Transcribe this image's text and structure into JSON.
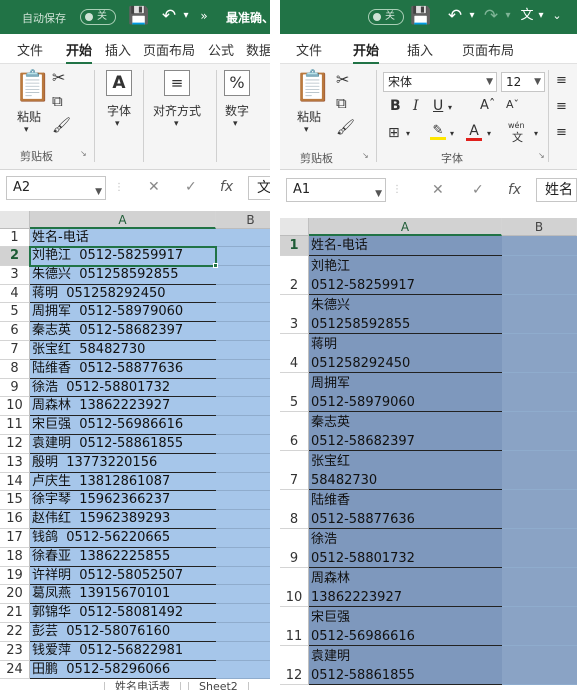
{
  "left": {
    "autosave_label": "自动保存",
    "autosave_state": "关",
    "doc_title": "最准确、",
    "tabs": [
      "文件",
      "开始",
      "插入",
      "页面布局",
      "公式",
      "数据"
    ],
    "active_tab": "开始",
    "ribbon": {
      "paste": "粘贴",
      "clipboard": "剪贴板",
      "font": "字体",
      "alignment": "对齐方式",
      "number": "数字"
    },
    "name_box": "A2",
    "formula_text": "文",
    "col_a": "A",
    "col_b": "B",
    "rows": [
      {
        "n": "1",
        "text": "姓名-电话"
      },
      {
        "n": "2",
        "text": "刘艳江  0512-58259917"
      },
      {
        "n": "3",
        "text": "朱德兴  051258592855"
      },
      {
        "n": "4",
        "text": "蒋明  051258292450"
      },
      {
        "n": "5",
        "text": "周拥军  0512-58979060"
      },
      {
        "n": "6",
        "text": "秦志英  0512-58682397"
      },
      {
        "n": "7",
        "text": "张宝红  58482730"
      },
      {
        "n": "8",
        "text": "陆维香  0512-58877636"
      },
      {
        "n": "9",
        "text": "徐浩  0512-58801732"
      },
      {
        "n": "10",
        "text": "周森林  13862223927"
      },
      {
        "n": "11",
        "text": "宋巨强  0512-56986616"
      },
      {
        "n": "12",
        "text": "袁建明  0512-58861855"
      },
      {
        "n": "13",
        "text": "殷明  13773220156"
      },
      {
        "n": "14",
        "text": "卢庆生  13812861087"
      },
      {
        "n": "15",
        "text": "徐宇琴  15962366237"
      },
      {
        "n": "16",
        "text": "赵伟红  15962389293"
      },
      {
        "n": "17",
        "text": "钱鸽  0512-56220665"
      },
      {
        "n": "18",
        "text": "徐春亚  13862225855"
      },
      {
        "n": "19",
        "text": "许祥明  0512-58052507"
      },
      {
        "n": "20",
        "text": "葛凤燕  13915670101"
      },
      {
        "n": "21",
        "text": "郭锦华  0512-58081492"
      },
      {
        "n": "22",
        "text": "彭芸  0512-58076160"
      },
      {
        "n": "23",
        "text": "钱爱萍  0512-56822981"
      },
      {
        "n": "24",
        "text": "田鹏  0512-58296066"
      }
    ],
    "sheet_tabs": [
      "姓名电话表",
      "Sheet2"
    ]
  },
  "right": {
    "tabs": [
      "文件",
      "开始",
      "插入",
      "页面布局"
    ],
    "active_tab": "开始",
    "font_name": "宋体",
    "font_size": "12",
    "ribbon": {
      "paste": "粘贴",
      "clipboard": "剪贴板",
      "font_group": "字体",
      "pinyin": "wén"
    },
    "name_box": "A1",
    "formula_text": "姓名",
    "col_a": "A",
    "col_b": "B",
    "rows": [
      {
        "n": "1",
        "text": "姓名-电话"
      },
      {
        "n": "2",
        "text": "刘艳江\n0512-58259917"
      },
      {
        "n": "3",
        "text": "朱德兴\n051258592855"
      },
      {
        "n": "4",
        "text": "蒋明\n051258292450"
      },
      {
        "n": "5",
        "text": "周拥军\n0512-58979060"
      },
      {
        "n": "6",
        "text": "秦志英\n0512-58682397"
      },
      {
        "n": "7",
        "text": "张宝红\n58482730"
      },
      {
        "n": "8",
        "text": "陆维香\n0512-58877636"
      },
      {
        "n": "9",
        "text": "徐浩\n0512-58801732"
      },
      {
        "n": "10",
        "text": "周森林\n13862223927"
      },
      {
        "n": "11",
        "text": "宋巨强\n0512-56986616"
      },
      {
        "n": "12",
        "text": "袁建明\n0512-58861855"
      }
    ]
  },
  "colors": {
    "excel_green": "#217346",
    "selection_left": "#a6c6ea",
    "selection_right": "#7e98bd",
    "selection_right_b": "#8aa3c5"
  }
}
